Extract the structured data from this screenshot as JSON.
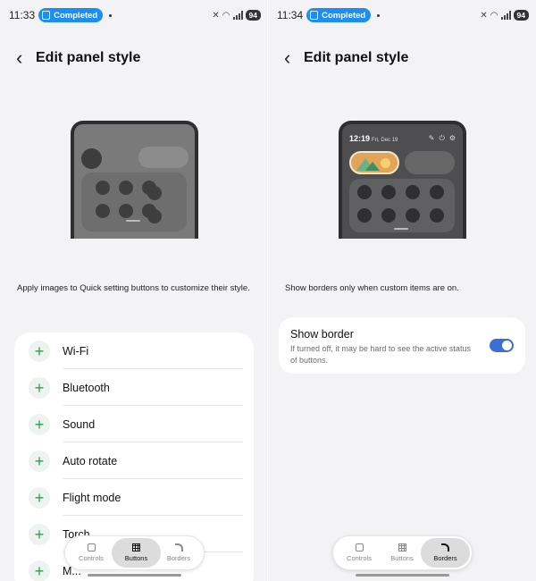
{
  "left": {
    "status": {
      "time": "11:33",
      "badge": "Completed",
      "battery": "94"
    },
    "header": {
      "title": "Edit panel style"
    },
    "description": "Apply images to Quick setting buttons to customize their style.",
    "items": [
      {
        "label": "Wi-Fi"
      },
      {
        "label": "Bluetooth"
      },
      {
        "label": "Sound"
      },
      {
        "label": "Auto rotate"
      },
      {
        "label": "Flight mode"
      },
      {
        "label": "Torch"
      },
      {
        "label": "M..."
      }
    ],
    "tabs": [
      {
        "label": "Controls",
        "active": false
      },
      {
        "label": "Buttons",
        "active": true
      },
      {
        "label": "Borders",
        "active": false
      }
    ]
  },
  "right": {
    "status": {
      "time": "11:34",
      "badge": "Completed",
      "battery": "94"
    },
    "header": {
      "title": "Edit panel style"
    },
    "preview": {
      "time": "12:19",
      "date": "Fri, Dec 19"
    },
    "description": "Show borders only when custom items are on.",
    "setting": {
      "title": "Show border",
      "subtitle": "If turned off, it may be hard to see the active status of buttons.",
      "enabled": true
    },
    "tabs": [
      {
        "label": "Controls",
        "active": false
      },
      {
        "label": "Buttons",
        "active": false
      },
      {
        "label": "Borders",
        "active": true
      }
    ]
  },
  "colors": {
    "accent": "#1f8df0",
    "toggle": "#3a6fd8",
    "plus": "#2f9b57"
  }
}
